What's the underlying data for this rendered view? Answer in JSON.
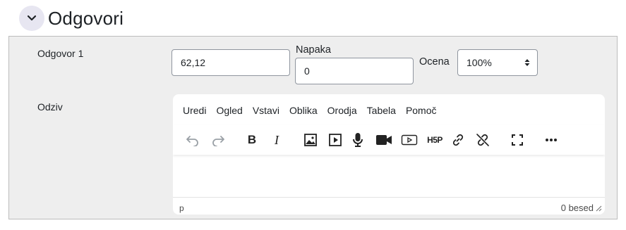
{
  "section": {
    "title": "Odgovori",
    "collapse_icon": "chevron-down-icon"
  },
  "answer": {
    "label": "Odgovor 1",
    "value": "62,12"
  },
  "tolerance": {
    "label": "Napaka",
    "value": "0"
  },
  "grade": {
    "label": "Ocena",
    "value": "100%"
  },
  "feedback": {
    "label": "Odziv",
    "menu": [
      "Uredi",
      "Ogled",
      "Vstavi",
      "Oblika",
      "Orodja",
      "Tabela",
      "Pomoč"
    ],
    "toolbar_icons": [
      "undo-icon",
      "redo-icon",
      "bold-icon",
      "italic-icon",
      "image-icon",
      "media-icon",
      "microphone-icon",
      "video-camera-icon",
      "video-player-icon",
      "h5p-icon",
      "link-icon",
      "unlink-icon",
      "fullscreen-icon",
      "more-icon"
    ],
    "bold_glyph": "B",
    "italic_glyph": "I",
    "h5p_glyph": "H5P",
    "status_path": "p",
    "word_count": "0 besed"
  }
}
